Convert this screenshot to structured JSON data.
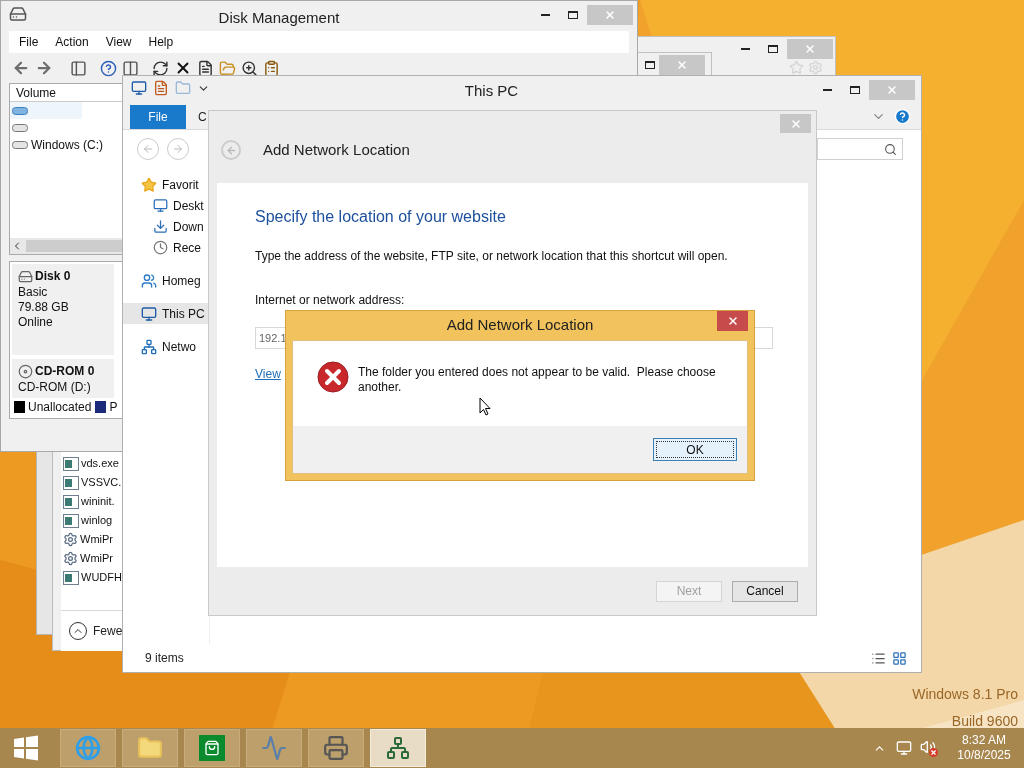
{
  "desktop": {
    "os_label": "Windows 8.1 Pro",
    "build_label": "Build 9600"
  },
  "task_manager": {
    "processes": [
      {
        "name": "vds.exe",
        "kind": "app"
      },
      {
        "name": "VSSVC.",
        "kind": "app"
      },
      {
        "name": "wininit.",
        "kind": "app"
      },
      {
        "name": "winlog",
        "kind": "app"
      },
      {
        "name": "WmiPr",
        "kind": "service"
      },
      {
        "name": "WmiPr",
        "kind": "service"
      },
      {
        "name": "WUDFH",
        "kind": "app"
      }
    ],
    "fewer_details": "Fewe"
  },
  "disk_management": {
    "title": "Disk Management",
    "menu": [
      "File",
      "Action",
      "View",
      "Help"
    ],
    "volume_header": "Volume",
    "volumes": [
      {
        "selected": true
      },
      {
        "selected": false
      },
      {
        "name": "Windows (C:)",
        "selected": false
      }
    ],
    "disks": [
      {
        "name": "Disk 0",
        "kind": "disk",
        "lines": [
          "Basic",
          "79.88 GB",
          "Online"
        ]
      },
      {
        "name": "CD-ROM 0",
        "kind": "cdrom",
        "lines": [
          "CD-ROM (D:)"
        ]
      }
    ],
    "legend": [
      {
        "label": "Unallocated",
        "color": "#000000"
      },
      {
        "label": "P",
        "color": "#1c2a7a"
      }
    ]
  },
  "explorer": {
    "title": "This PC",
    "ribbon_tabs": [
      {
        "label": "File",
        "selected": true
      },
      {
        "label": "C",
        "selected": false
      }
    ],
    "nav": [
      {
        "label": "Favorit",
        "kind": "favorites",
        "selected": false,
        "children": [
          {
            "label": "Deskt",
            "kind": "desktop",
            "selected": false
          },
          {
            "label": "Down",
            "kind": "downloads",
            "selected": false
          },
          {
            "label": "Rece",
            "kind": "recent",
            "selected": false
          }
        ]
      },
      {
        "label": "Homeg",
        "kind": "homegroup",
        "selected": false
      },
      {
        "label": "This PC",
        "kind": "pc",
        "selected": true
      },
      {
        "label": "Netwo",
        "kind": "network",
        "selected": false
      }
    ],
    "status": "9 items"
  },
  "wizard": {
    "title": "Add Network Location",
    "heading": "Specify the location of your website",
    "description": "Type the address of the website, FTP site, or network location that this shortcut will open.",
    "address_label": "Internet or network address:",
    "address_value": "192.1",
    "link": "View",
    "buttons": [
      {
        "label": "Next",
        "disabled": true
      },
      {
        "label": "Cancel",
        "disabled": false
      }
    ]
  },
  "error_dialog": {
    "title": "Add Network Location",
    "message": "The folder you entered does not appear to be valid.  Please choose another.",
    "button": "OK"
  },
  "taskbar": {
    "apps": [
      {
        "kind": "browser",
        "selected": false
      },
      {
        "kind": "files",
        "selected": false
      },
      {
        "kind": "store",
        "selected": false
      },
      {
        "kind": "monitor",
        "selected": false
      },
      {
        "kind": "printer",
        "selected": false
      },
      {
        "kind": "network-wizard",
        "selected": true
      }
    ],
    "volume_muted": true,
    "time": "8:32 AM",
    "date": "10/8/2025"
  }
}
